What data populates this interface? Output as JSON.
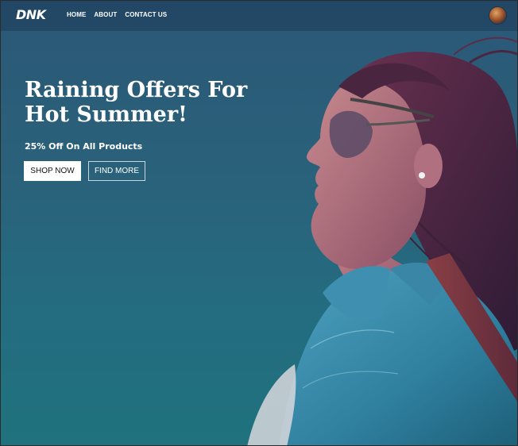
{
  "header": {
    "logo": "DNK",
    "nav": [
      "HOME",
      "ABOUT",
      "CONTACT US"
    ]
  },
  "hero": {
    "title": "Raining Offers For Hot Summer!",
    "subtitle": "25% Off On All Products",
    "primary_button": "SHOP NOW",
    "secondary_button": "FIND MORE"
  },
  "colors": {
    "background_top": "#2b5878",
    "background_bottom": "#1f727e",
    "primary_button_bg": "#ffffff",
    "primary_button_text": "#111111",
    "text": "#ffffff"
  }
}
